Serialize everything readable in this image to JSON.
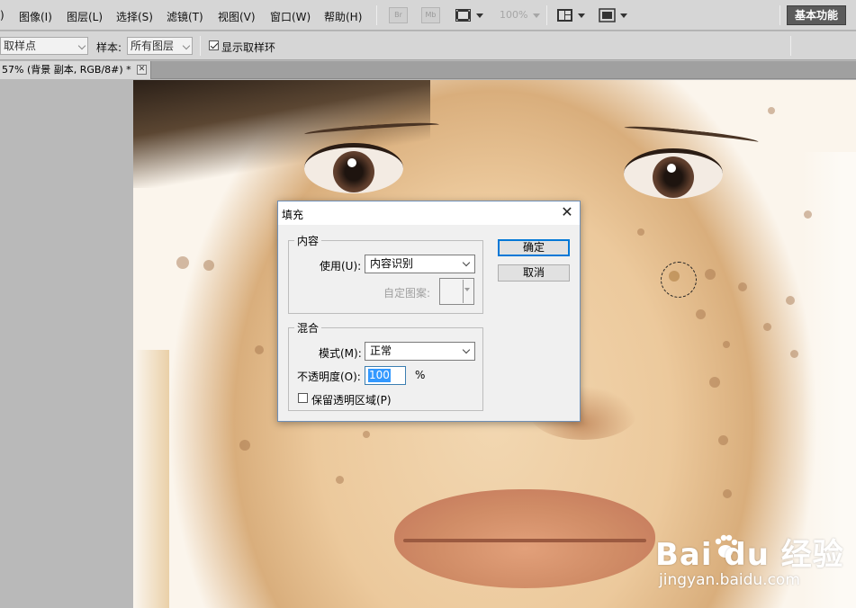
{
  "menu": {
    "items": [
      "图像(I)",
      "图层(L)",
      "选择(S)",
      "滤镜(T)",
      "视图(V)",
      "窗口(W)",
      "帮助(H)"
    ],
    "leading_fragment": ")",
    "bridge_icon": "Br",
    "minibridge_icon": "Mb",
    "zoom": "100%",
    "workspace": "基本功能"
  },
  "options": {
    "sample_point_value": "取样点",
    "sample_label": "样本:",
    "sample_value": "所有图层",
    "show_ring_label": "显示取样环",
    "show_ring_checked": true
  },
  "document_tab": {
    "title": "57% (背景 副本, RGB/8#) *",
    "close": "✕"
  },
  "watermark": {
    "main": "Bai du 经验",
    "sub": "jingyan.baidu.com"
  },
  "dialog": {
    "title": "填充",
    "close": "✕",
    "contents": {
      "legend": "内容",
      "use_label": "使用(U):",
      "use_value": "内容识别",
      "custom_pattern_label": "自定图案:"
    },
    "blending": {
      "legend": "混合",
      "mode_label": "模式(M):",
      "mode_value": "正常",
      "opacity_label": "不透明度(O):",
      "opacity_value": "100",
      "opacity_unit": "%",
      "preserve_label": "保留透明区域(P)",
      "preserve_checked": false
    },
    "ok": "确定",
    "cancel": "取消"
  }
}
